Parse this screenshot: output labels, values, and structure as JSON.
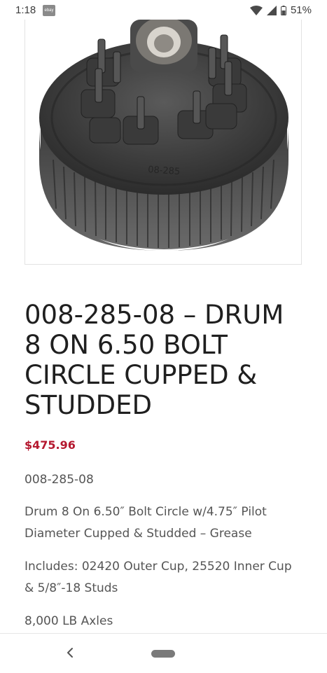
{
  "status_bar": {
    "time": "1:18",
    "app_icon_label": "ebay",
    "battery": "51%"
  },
  "product": {
    "image_icon": "brake-drum-image",
    "title": "008-285-08 – DRUM 8 ON 6.50 BOLT CIRCLE CUPPED & STUDDED",
    "price": "$475.96",
    "sku": "008-285-08",
    "description": "Drum 8 On 6.50″ Bolt Circle w/4.75″ Pilot Diameter Cupped & Studded – Grease",
    "includes": "Includes: 02420 Outer Cup, 25520 Inner Cup & 5/8″-18 Studs",
    "axles": "8,000 LB Axles"
  },
  "colors": {
    "price": "#b5182f",
    "title": "#1f1f1f",
    "body": "#555555"
  }
}
